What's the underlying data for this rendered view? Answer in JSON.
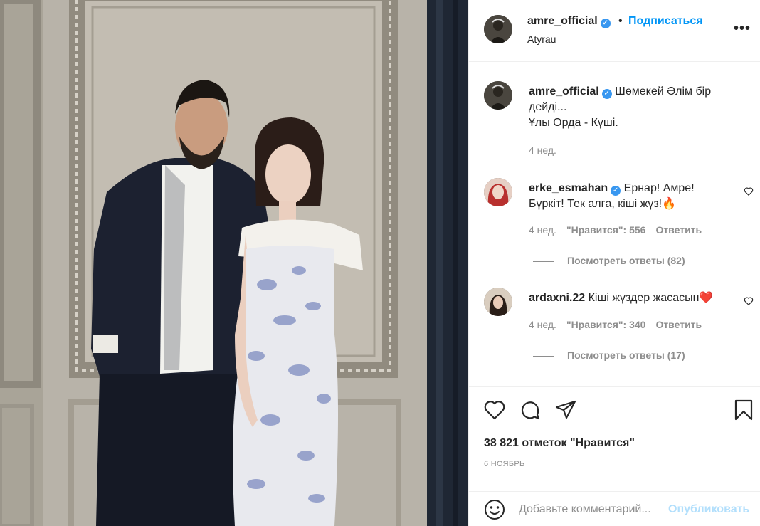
{
  "post": {
    "author": "amre_official",
    "location": "Atyrau",
    "follow_label": "Подписаться",
    "dot": "•",
    "more": "•••",
    "verified_mark": "✓"
  },
  "caption": {
    "user": "amre_official",
    "text": "Шөмекей Әлім бір дейді...\nҰлы Орда - Күші.",
    "line1": "Шөмекей Әлім бір",
    "line2": "дейді...",
    "line3": "Ұлы Орда - Күші.",
    "time": "4 нед."
  },
  "comments": [
    {
      "user": "erke_esmahan",
      "line1": "Ернар! Амре!",
      "line2": "Бүркіт! Тек алға, кіші жүз!",
      "emoji": "🔥",
      "time": "4 нед.",
      "likes": "\"Нравится\": 556",
      "reply_label": "Ответить",
      "view_replies": "Посмотреть ответы (82)"
    },
    {
      "user": "ardaxni.22",
      "line1": "Кіші жүздер жасасын",
      "emoji": "❤️",
      "time": "4 нед.",
      "likes": "\"Нравится\": 340",
      "reply_label": "Ответить",
      "view_replies": "Посмотреть ответы (17)"
    }
  ],
  "actions": {
    "icons": [
      "heart-icon",
      "comment-icon",
      "share-icon",
      "bookmark-icon"
    ]
  },
  "likes_count": "38 821 отметок \"Нравится\"",
  "date": "6 НОЯБРЬ",
  "add_comment": {
    "placeholder": "Добавьте комментарий...",
    "publish_label": "Опубликовать"
  },
  "colors": {
    "accent": "#0095f6",
    "verified": "#3897f0",
    "muted": "#8e8e8e",
    "publish_disabled": "#b2dffc",
    "heart_red": "#ed4956"
  }
}
